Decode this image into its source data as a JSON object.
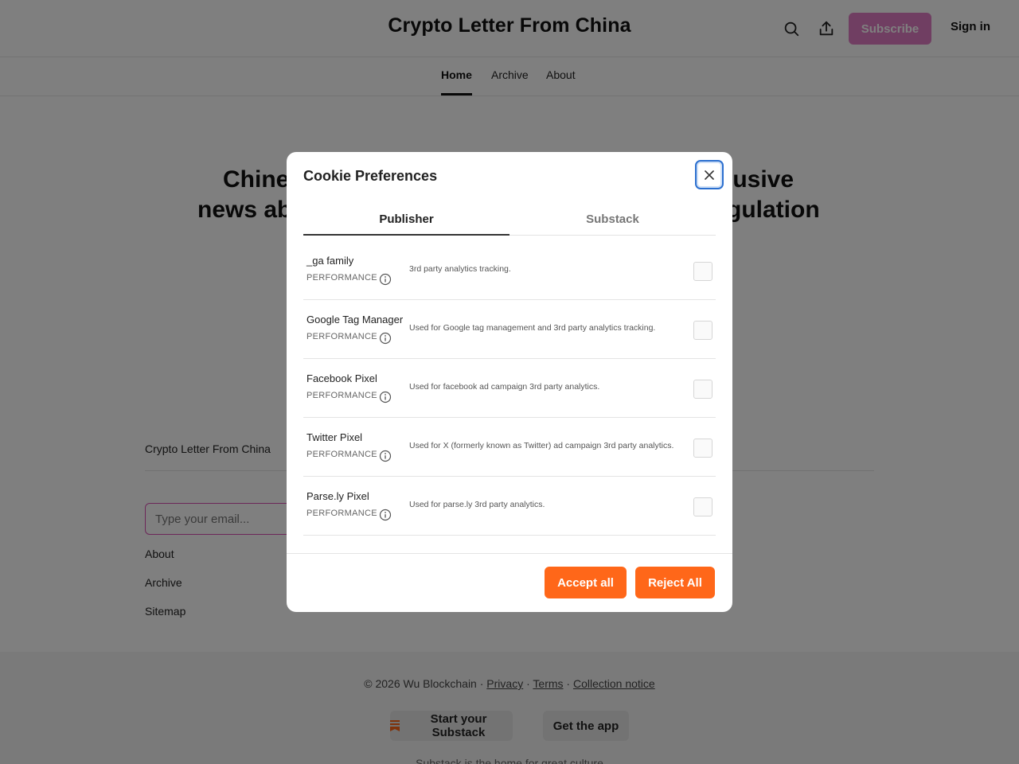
{
  "header": {
    "title": "Crypto Letter From China",
    "search_icon": "search-icon",
    "share_icon": "share-icon",
    "subscribe_label": "Subscribe",
    "signin_label": "Sign in"
  },
  "nav": {
    "items": [
      "Home",
      "Archive",
      "About"
    ],
    "active": "Home"
  },
  "hero": {
    "line1_left": "Chine",
    "line1_right": "lusive",
    "line2_left": "news ab",
    "line2_right": "gulation"
  },
  "footer": {
    "publication": "Crypto Letter From China",
    "email_placeholder": "Type your email...",
    "links": [
      "About",
      "Archive",
      "Sitemap"
    ],
    "copyright": "© 2026 Wu Blockchain · ",
    "privacy": "Privacy",
    "terms": "Terms",
    "collection": "Collection notice",
    "start_label": "Start your Substack",
    "app_label": "Get the app",
    "tagline": "Substack is the home for great culture"
  },
  "modal": {
    "title": "Cookie Preferences",
    "tabs": [
      "Publisher",
      "Substack"
    ],
    "active_tab": "Publisher",
    "rows": [
      {
        "name": "_ga family",
        "category": "PERFORMANCE",
        "description": "3rd party analytics tracking.",
        "checked": false
      },
      {
        "name": "Google Tag Manager",
        "category": "PERFORMANCE",
        "description": "Used for Google tag management and 3rd party analytics tracking.",
        "checked": false
      },
      {
        "name": "Facebook Pixel",
        "category": "PERFORMANCE",
        "description": "Used for facebook ad campaign 3rd party analytics.",
        "checked": false
      },
      {
        "name": "Twitter Pixel",
        "category": "PERFORMANCE",
        "description": "Used for X (formerly known as Twitter) ad campaign 3rd party analytics.",
        "checked": false
      },
      {
        "name": "Parse.ly Pixel",
        "category": "PERFORMANCE",
        "description": "Used for parse.ly 3rd party analytics.",
        "checked": false
      }
    ],
    "accept_label": "Accept all",
    "reject_label": "Reject All"
  },
  "colors": {
    "accent": "#ff6719",
    "subscribe": "#e07cc4",
    "focus_ring": "#2b6fcf"
  }
}
